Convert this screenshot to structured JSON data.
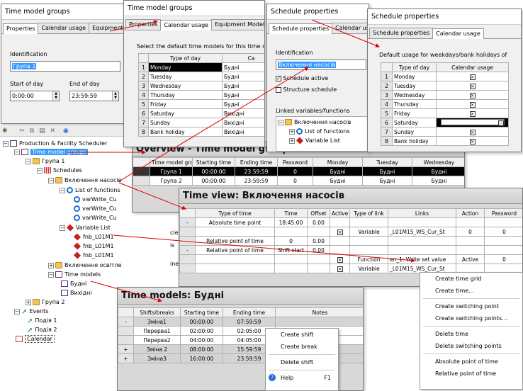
{
  "w1": {
    "title": "Time model groups",
    "tabs": [
      "Properties",
      "Calendar usage",
      "Equipment M"
    ],
    "identification_label": "Identification",
    "identification_value": "Група 1",
    "start_label": "Start of day",
    "start_value": "0:00:00",
    "end_label": "End of day",
    "end_value": "23:59:59"
  },
  "w2": {
    "title": "Time model groups",
    "tabs": [
      "Properties",
      "Calendar usage",
      "Equipment Models"
    ],
    "instruction": "Select the default time models for this time mod",
    "col_type": "Type of day",
    "col_ca": "Ca",
    "rows": [
      {
        "n": "1",
        "day": "Monday",
        "model": "Будні"
      },
      {
        "n": "2",
        "day": "Tuesday",
        "model": "Будні"
      },
      {
        "n": "3",
        "day": "Wednesday",
        "model": "Будні"
      },
      {
        "n": "4",
        "day": "Thursday",
        "model": "Будні"
      },
      {
        "n": "5",
        "day": "Friday",
        "model": "Будні"
      },
      {
        "n": "6",
        "day": "Saturday",
        "model": "Вихідні"
      },
      {
        "n": "7",
        "day": "Sunday",
        "model": "Вихідні"
      },
      {
        "n": "8",
        "day": "Bank holiday",
        "model": "Вихідні"
      }
    ]
  },
  "w3": {
    "title": "Schedule properties",
    "tabs": [
      "Schedule properties",
      "Calendar usa"
    ],
    "identification_label": "Identification",
    "identification_value": "Включення насосів",
    "schedule_active": "Schedule active",
    "structure_schedule": "Structure schedule",
    "linked_label": "Linked variables/functions",
    "tree": [
      "Включення насосів",
      "List of functions",
      "Variable List"
    ]
  },
  "w4": {
    "title": "Schedule properties",
    "tabs": [
      "Schedule properties",
      "Calendar usage"
    ],
    "instruction": "Default usage for weekdays/bank holidays of",
    "col_type": "Type of day",
    "col_usage": "Calendar usage",
    "rows": [
      {
        "n": "1",
        "day": "Monday",
        "checked": true
      },
      {
        "n": "2",
        "day": "Tuesday",
        "checked": true
      },
      {
        "n": "3",
        "day": "Wednesday",
        "checked": true
      },
      {
        "n": "4",
        "day": "Thursday",
        "checked": true
      },
      {
        "n": "5",
        "day": "Friday",
        "checked": true
      },
      {
        "n": "6",
        "day": "Saturday",
        "checked": false
      },
      {
        "n": "7",
        "day": "Sunday",
        "checked": true
      },
      {
        "n": "8",
        "day": "Bank holiday",
        "checked": true
      }
    ]
  },
  "tree": {
    "root": "Production & Facility Scheduler",
    "groups": "Time model groups",
    "group1": "Група 1",
    "schedules": "Schedules",
    "sched1": "Включення насосів",
    "lof": "List of functions",
    "vw1": "varWrite_Cu",
    "vw2": "varWrite_Cu",
    "vw3": "varWrite_Cu",
    "varlist": "Variable List",
    "fnb1": "fnb_L01M1",
    "fnb2": "fnb_L01M1",
    "fnb3": "fnb_L01M1",
    "sched2": "Включення освітле",
    "timemodels": "Time models",
    "tm1": "Будні",
    "tm2": "Вихідні",
    "group2": "Група 2",
    "events": "Events",
    "ev1": "Подія 1",
    "ev2": "Подія 2",
    "calendar": "Calendar"
  },
  "overview": {
    "title": "Overview - Time model groups",
    "cols": [
      "Time model grou",
      "Starting time",
      "Ending time",
      "Password",
      "Monday",
      "Tuesday",
      "Wednesday"
    ],
    "rows": [
      [
        "Група 1",
        "00:00:00",
        "23:59:59",
        "0",
        "Будні",
        "Будні",
        "Будні"
      ],
      [
        "Група 2",
        "00:00:00",
        "23:59:59",
        "0",
        "Будні",
        "Будні",
        "Будні"
      ]
    ]
  },
  "timeview": {
    "title": "Time view: Включення насосів",
    "cols": [
      "Type of time",
      "Time",
      "Offset",
      "Active",
      "Type of link",
      "Links",
      "Action",
      "Password"
    ],
    "rows": [
      {
        "rh": "-",
        "type": "Absolute time point",
        "time": "18:45:00",
        "offset": "0.00",
        "active": "",
        "link": "",
        "links": "",
        "action": "",
        "pw": ""
      },
      {
        "rh": "",
        "type": "",
        "time": "",
        "offset": "",
        "active": "x",
        "link": "Variable",
        "links": "_L01M15_WS_Cur_St",
        "action": "0",
        "pw": "0"
      },
      {
        "rh": "",
        "type": "Relative point of time",
        "time": "0",
        "offset": "0.00",
        "active": "",
        "link": "",
        "links": "",
        "action": "",
        "pw": ""
      },
      {
        "rh": "-",
        "type": "Relative point of time",
        "time": "Shift start",
        "offset": "0.00",
        "active": "",
        "link": "",
        "links": "",
        "action": "",
        "pw": ""
      },
      {
        "rh": "",
        "type": "",
        "time": "",
        "offset": "",
        "active": "x",
        "link": "Function",
        "links": "en_1: Write set value",
        "action": "Active",
        "pw": "0"
      },
      {
        "rh": "",
        "type": "",
        "time": "",
        "offset": "",
        "active": "x",
        "link": "Variable",
        "links": "_L01M15_WS_Cur_St",
        "action": "",
        "pw": ""
      }
    ],
    "side_labels": [
      "cie",
      "is",
      "ine"
    ]
  },
  "timemodels": {
    "title": "Time models: Будні",
    "cols": [
      "Shifts/breaks",
      "Starting time",
      "Ending time",
      "Notes"
    ],
    "rows": [
      {
        "rh": "-",
        "name": "Зміна1",
        "start": "00:00:00",
        "end": "07:59:59",
        "shade": true
      },
      {
        "rh": "",
        "name": "Перерва1",
        "start": "02:00:00",
        "end": "02:05:00",
        "shade": false
      },
      {
        "rh": "",
        "name": "Перерва2",
        "start": "04:00:00",
        "end": "04:05:00",
        "shade": false
      },
      {
        "rh": "+",
        "name": "Зміна 2",
        "start": "08:00:00",
        "end": "15:59:59",
        "shade": true
      },
      {
        "rh": "+",
        "name": "Зміна3",
        "start": "16:00:00",
        "end": "23:59:59",
        "shade": true
      }
    ]
  },
  "menu1": {
    "items": [
      "Create shift",
      "Create break",
      "Delete shift",
      "Help"
    ],
    "help_key": "F1"
  },
  "menu2": {
    "items": [
      "Create time grid",
      "Create time...",
      "Create switching point",
      "Create switching points...",
      "Delete time",
      "Delete switching points",
      "Absolute point of time",
      "Relative point of time"
    ]
  }
}
